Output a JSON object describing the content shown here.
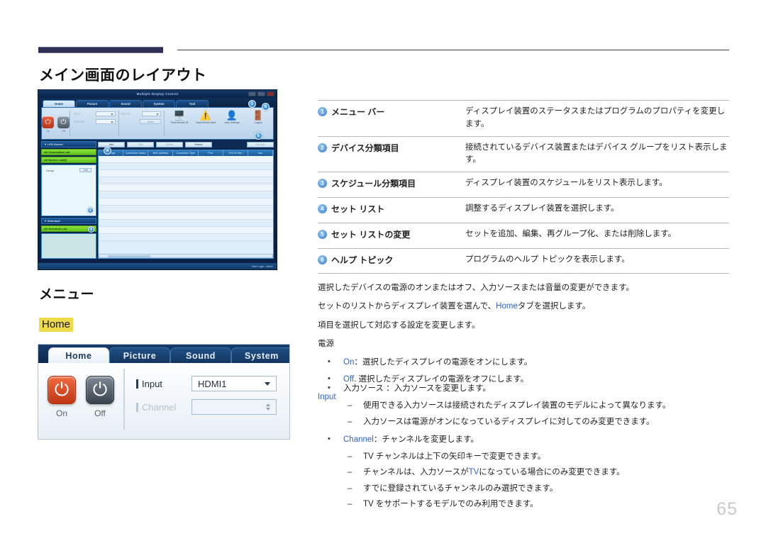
{
  "page": {
    "title": "メイン画面のレイアウト",
    "section_title": "メニュー",
    "highlight_label": "Home",
    "page_number": "65"
  },
  "mdc_screenshot": {
    "window_title": "Multiple Display Control",
    "tabs": [
      "Home",
      "Picture",
      "Sound",
      "System",
      "Tool"
    ],
    "power": {
      "on": "On",
      "off": "Off"
    },
    "fields": {
      "input": "Input",
      "channel": "Channel",
      "volume": "Volume",
      "mute": "Mute"
    },
    "toolbar_icons": [
      {
        "name": "fault-device-id",
        "label": "Fault Device ID",
        "glyph": "🖥"
      },
      {
        "name": "fault-device-alert",
        "label": "Fault Device Alert",
        "glyph": "⚠"
      },
      {
        "name": "user-settings",
        "label": "User Settings",
        "glyph": "👤"
      },
      {
        "name": "logout",
        "label": "Logout",
        "glyph": "🚪"
      }
    ],
    "sidebar": {
      "device_panel": "LFD Device",
      "all_connection_list": "All Connection List",
      "all_device_list": "All Device List(0)",
      "group": "Group",
      "group_edit": "Edit",
      "schedule_panel": "Schedule",
      "all_schedule_list": "All Schedule List"
    },
    "buttons": [
      "Add",
      "Edit",
      "Delete",
      "Detect",
      "Refresh"
    ],
    "grid_headers": [
      "Settings",
      "Connection Status",
      "MAC Address",
      "Connection Type",
      "Port",
      "LFD ID Ran",
      "Sou"
    ],
    "status_bar": "User Login : admin",
    "badges": [
      "1",
      "2",
      "3",
      "4",
      "5",
      "6"
    ]
  },
  "home_screenshot": {
    "tabs": [
      "Home",
      "Picture",
      "Sound",
      "System"
    ],
    "active_tab": "Home",
    "power_on": "On",
    "power_off": "Off",
    "input_label": "Input",
    "input_value": "HDMI1",
    "channel_label": "Channel",
    "channel_value": ""
  },
  "legend": [
    {
      "num": "1",
      "term": "メニュー バー",
      "desc": "ディスプレイ装置のステータスまたはプログラムのプロパティを変更します。"
    },
    {
      "num": "2",
      "term": "デバイス分類項目",
      "desc": "接続されているデバイス装置またはデバイス グループをリスト表示します。"
    },
    {
      "num": "3",
      "term": "スケジュール分類項目",
      "desc": "ディスプレイ装置のスケジュールをリスト表示します。"
    },
    {
      "num": "4",
      "term": "セット リスト",
      "desc": "調整するディスプレイ装置を選択します。"
    },
    {
      "num": "5",
      "term": "セット リストの変更",
      "desc": "セットを追加、編集、再グループ化、または削除します。"
    },
    {
      "num": "6",
      "term": "ヘルプ トピック",
      "desc": "プログラムのヘルプ トピックを表示します。"
    }
  ],
  "body": {
    "p1": "選択したデバイスの電源のオンまたはオフ、入力ソースまたは音量の変更ができます。",
    "p2_before": "セットのリストからディスプレイ装置を選んで、",
    "p2_link": "Home",
    "p2_after": "タブを選択します。",
    "p3": "項目を選択して対応する設定を変更します。",
    "p4": "電源",
    "bullet_on_label": "On",
    "bullet_on_text": "：選択したディスプレイの電源をオンにします。",
    "bullet_off_label": "Off",
    "bullet_off_text": ". 選択したディスプレイの電源をオフにします。",
    "input_heading": "Input",
    "bullet_input": "入力ソース ：入力ソースを変更します。",
    "sub_input_1": "使用できる入力ソースは接続されたディスプレイ装置のモデルによって異なります。",
    "sub_input_2": "入力ソースは電源がオンになっているディスプレイに対してのみ変更できます。",
    "bullet_channel_label": "Channel",
    "bullet_channel_text": "：チャンネルを変更します。",
    "sub_ch_1": "TV チャンネルは上下の矢印キーで変更できます。",
    "sub_ch_2_a": "チャンネルは、入力ソースが",
    "sub_ch_2_link": "TV",
    "sub_ch_2_b": "になっている場合にのみ変更できます。",
    "sub_ch_3": "すでに登録されているチャンネルのみ選択できます。",
    "sub_ch_4": "TV をサポートするモデルでのみ利用できます。"
  }
}
